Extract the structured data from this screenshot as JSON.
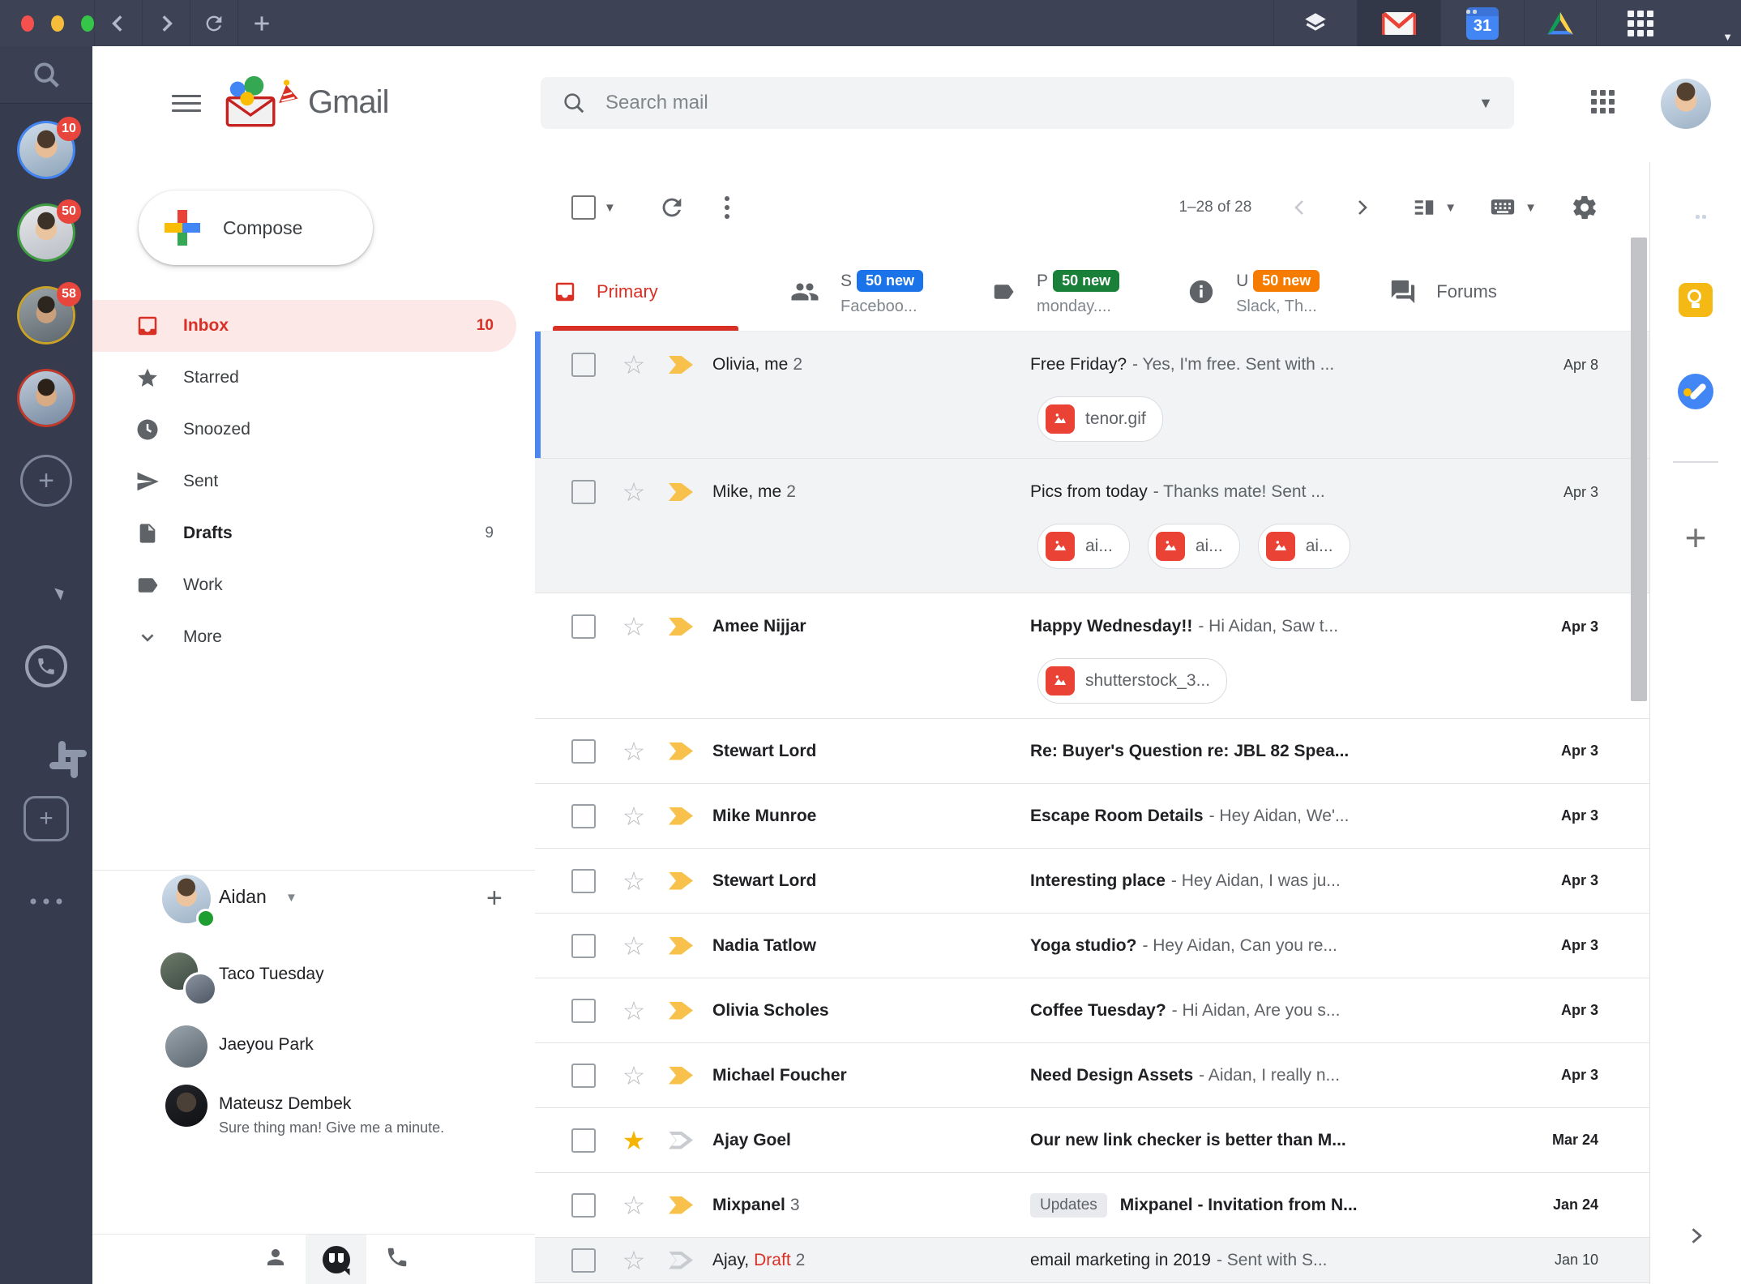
{
  "window": {
    "topbar": {
      "traffic_lights": [
        "close",
        "minimize",
        "zoom"
      ],
      "nav_buttons": [
        "back",
        "forward",
        "refresh",
        "new-tab"
      ],
      "app_tabs": [
        {
          "icon": "layers-icon",
          "active": false
        },
        {
          "icon": "gmail-icon",
          "active": true
        },
        {
          "icon": "calendar-icon",
          "day": "31",
          "active": false
        },
        {
          "icon": "drive-icon",
          "active": false
        },
        {
          "icon": "apps-grid-icon",
          "active": false
        }
      ]
    }
  },
  "app_sidebar": {
    "search_icon": "search-icon",
    "avatars": [
      {
        "badge": "10",
        "ring": "#4285f4",
        "photo": "photo1"
      },
      {
        "badge": "50",
        "ring": "#3f9d42",
        "photo": "photo2"
      },
      {
        "badge": "58",
        "ring": "#c9a227",
        "photo": "photo3"
      },
      {
        "badge": "",
        "ring": "#c0392b",
        "photo": "photo4"
      }
    ],
    "add_label": "+",
    "workspace_add_label": "+",
    "apps": [
      "messenger",
      "whatsapp",
      "slack"
    ]
  },
  "gmail": {
    "header": {
      "logo_text": "Gmail",
      "search_placeholder": "Search mail"
    },
    "nav": {
      "compose_label": "Compose",
      "items": [
        {
          "icon": "inbox-icon",
          "label": "Inbox",
          "count": "10",
          "active": true
        },
        {
          "icon": "star-icon",
          "label": "Starred",
          "count": ""
        },
        {
          "icon": "clock-icon",
          "label": "Snoozed",
          "count": ""
        },
        {
          "icon": "send-icon",
          "label": "Sent",
          "count": ""
        },
        {
          "icon": "file-icon",
          "label": "Drafts",
          "count": "9",
          "bold": true
        },
        {
          "icon": "tag-icon",
          "label": "Work",
          "count": ""
        },
        {
          "icon": "chevron-down-icon",
          "label": "More",
          "count": ""
        }
      ]
    },
    "chat": {
      "me": {
        "name": "Aidan",
        "online": true
      },
      "add_label": "+",
      "contacts": [
        {
          "name": "Taco Tuesday",
          "message": "",
          "group": true,
          "photos": [
            "photoT1",
            "photoT2"
          ]
        },
        {
          "name": "Jaeyou Park",
          "message": "",
          "photos": [
            "photoJ"
          ]
        },
        {
          "name": "Mateusz Dembek",
          "message": "Sure thing man! Give me a minute.",
          "photos": [
            "photoM"
          ]
        }
      ],
      "bottom_tabs": [
        {
          "icon": "person-icon",
          "active": false
        },
        {
          "icon": "hangouts-icon",
          "active": true
        },
        {
          "icon": "phone-icon",
          "active": false
        }
      ]
    },
    "toolbar": {
      "range": "1–28 of 28"
    },
    "tabs": [
      {
        "label": "Primary",
        "active": true
      },
      {
        "label": "Social",
        "visible_letter": "S",
        "badge": "50 new",
        "badge_color": "#1a73e8",
        "sublabel": "Faceboo...",
        "icon": "people-icon"
      },
      {
        "label": "Promotions",
        "visible_letter": "P",
        "badge": "50 new",
        "badge_color": "#188038",
        "sublabel": "monday....",
        "icon": "tag-icon"
      },
      {
        "label": "Updates",
        "visible_letter": "U",
        "badge": "50 new",
        "badge_color": "#f57c00",
        "sublabel": "Slack, Th...",
        "icon": "info-icon"
      },
      {
        "label": "Forums",
        "icon": "forum-icon"
      }
    ],
    "emails": [
      {
        "sender": "Olivia, me",
        "count": "2",
        "subject": "Free Friday?",
        "snippet": "- Yes, I'm free. Sent with ...",
        "date": "Apr 8",
        "read": true,
        "focused": true,
        "importance": "yellow",
        "starred": false,
        "attachments": [
          "tenor.gif"
        ]
      },
      {
        "sender": "Mike, me",
        "count": "2",
        "subject": "Pics from today",
        "snippet": "- Thanks mate! Sent ...",
        "date": "Apr 3",
        "read": true,
        "importance": "yellow",
        "starred": false,
        "attachments": [
          "ai...",
          "ai...",
          "ai..."
        ]
      },
      {
        "sender": "Amee Nijjar",
        "count": "",
        "subject": "Happy Wednesday!!",
        "snippet": "- Hi Aidan, Saw t...",
        "date": "Apr 3",
        "read": false,
        "importance": "yellow",
        "starred": false,
        "attachments": [
          "shutterstock_3..."
        ]
      },
      {
        "sender": "Stewart Lord",
        "count": "",
        "subject": "Re: Buyer's Question re: JBL 82 Spea...",
        "snippet": "",
        "date": "Apr 3",
        "read": false,
        "importance": "yellow",
        "starred": false
      },
      {
        "sender": "Mike Munroe",
        "count": "",
        "subject": "Escape Room Details",
        "snippet": "- Hey Aidan, We'...",
        "date": "Apr 3",
        "read": false,
        "importance": "yellow",
        "starred": false
      },
      {
        "sender": "Stewart Lord",
        "count": "",
        "subject": "Interesting place",
        "snippet": "- Hey Aidan, I was ju...",
        "date": "Apr 3",
        "read": false,
        "importance": "yellow",
        "starred": false
      },
      {
        "sender": "Nadia Tatlow",
        "count": "",
        "subject": "Yoga studio?",
        "snippet": "- Hey Aidan, Can you re...",
        "date": "Apr 3",
        "read": false,
        "importance": "yellow",
        "starred": false
      },
      {
        "sender": "Olivia Scholes",
        "count": "",
        "subject": "Coffee Tuesday?",
        "snippet": "- Hi Aidan, Are you s...",
        "date": "Apr 3",
        "read": false,
        "importance": "yellow",
        "starred": false
      },
      {
        "sender": "Michael Foucher",
        "count": "",
        "subject": "Need Design Assets",
        "snippet": "- Aidan, I really n...",
        "date": "Apr 3",
        "read": false,
        "importance": "yellow",
        "starred": false
      },
      {
        "sender": "Ajay Goel",
        "count": "",
        "subject": "Our new link checker is better than M...",
        "snippet": "",
        "date": "Mar 24",
        "read": false,
        "importance": "outline",
        "starred": true
      },
      {
        "sender": "Mixpanel",
        "count": "3",
        "label": "Updates",
        "subject": "Mixpanel - Invitation from N...",
        "snippet": "",
        "date": "Jan 24",
        "read": false,
        "importance": "yellow",
        "starred": false
      },
      {
        "sender": "Ajay,",
        "draft": "Draft",
        "count": "2",
        "subject": "email marketing in 2019",
        "snippet": "- Sent with S...",
        "date": "Jan 10",
        "read": true,
        "importance": "outline",
        "starred": false
      }
    ],
    "widgets": {
      "calendar_day": "31",
      "items": [
        "calendar",
        "keep",
        "tasks"
      ],
      "add_label": "+"
    }
  }
}
